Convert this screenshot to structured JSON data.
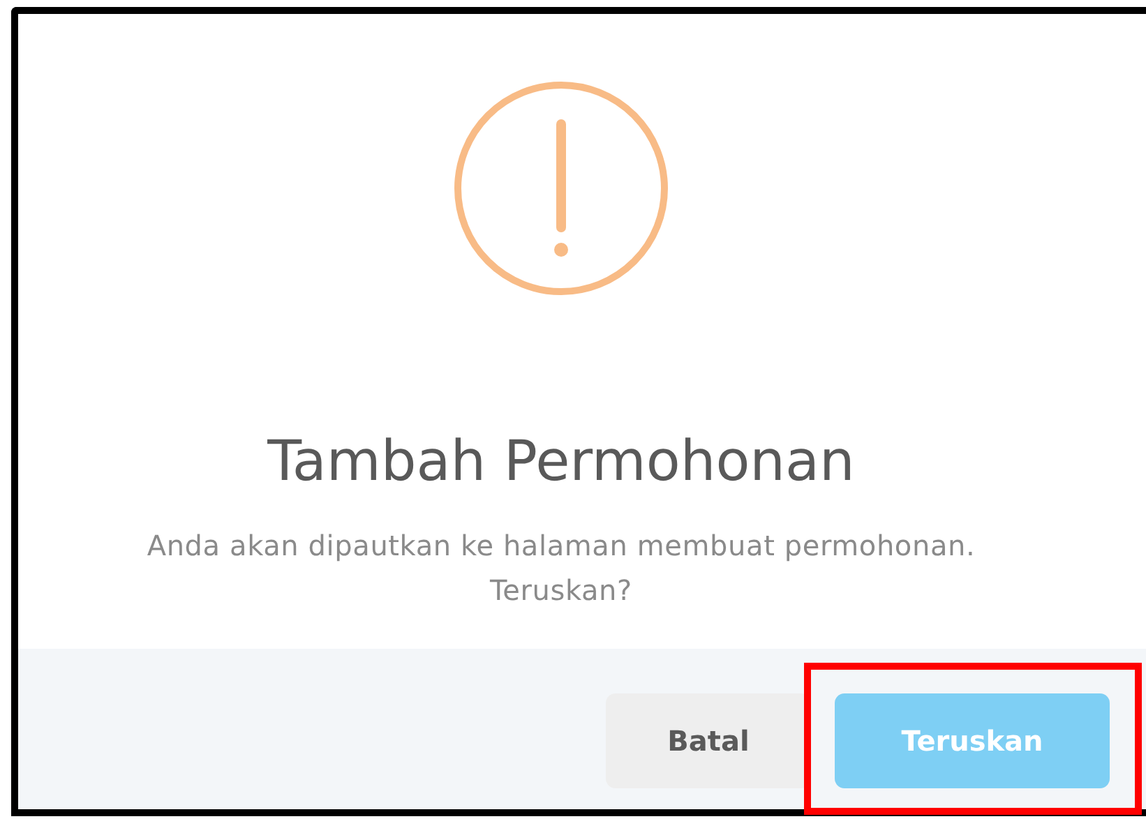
{
  "dialog": {
    "title": "Tambah Permohonan",
    "message": "Anda akan dipautkan ke halaman membuat permohonan. Teruskan?",
    "buttons": [
      {
        "label": "Batal",
        "kind": "cancel",
        "highlighted": false
      },
      {
        "label": "Teruskan",
        "kind": "confirm",
        "highlighted": true
      }
    ]
  }
}
